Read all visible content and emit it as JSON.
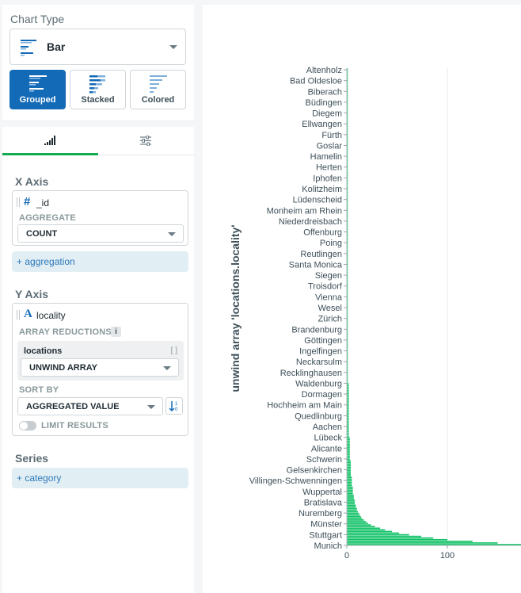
{
  "chart_type": {
    "title": "Chart Type",
    "selected": "Bar",
    "subtypes": [
      {
        "label": "Grouped",
        "active": true
      },
      {
        "label": "Stacked",
        "active": false
      },
      {
        "label": "Colored",
        "active": false
      }
    ]
  },
  "encode": {
    "tabs": [
      {
        "icon": "bar-signal-icon",
        "active": true
      },
      {
        "icon": "sliders-icon",
        "active": false
      }
    ],
    "x_axis": {
      "title": "X Axis",
      "field": "_id",
      "field_icon": "#",
      "aggregate_label": "AGGREGATE",
      "aggregate_value": "COUNT",
      "add_label": "+ aggregation"
    },
    "y_axis": {
      "title": "Y Axis",
      "field": "locality",
      "field_icon": "A",
      "array_reductions_label": "ARRAY REDUCTIONS",
      "info": "i",
      "array_field": "locations",
      "array_field_icon": "[ ]",
      "reduction_value": "UNWIND ARRAY",
      "sort_label": "SORT BY",
      "sort_value": "AGGREGATED VALUE",
      "limit_label": "LIMIT RESULTS"
    },
    "series": {
      "title": "Series",
      "add_label": "+ category"
    }
  },
  "colors": {
    "accent_blue": "#136ab6",
    "bar_green": "#13c268",
    "active_tab": "#13aa52"
  },
  "chart_data": {
    "type": "bar",
    "orientation": "horizontal",
    "ylabel": "unwind array 'locations.locality'",
    "xlabel": "",
    "xlim": [
      0,
      175
    ],
    "x_ticks": [
      0,
      100
    ],
    "grid": true,
    "category_labels": [
      "Altenholz",
      "Bad Oldesloe",
      "Biberach",
      "Büdingen",
      "Diegem",
      "Ellwangen",
      "Fürth",
      "Goslar",
      "Hamelin",
      "Herten",
      "Iphofen",
      "Kolitzheim",
      "Lüdenscheid",
      "Monheim am Rhein",
      "Niederdreisbach",
      "Offenburg",
      "Poing",
      "Reutlingen",
      "Santa Monica",
      "Siegen",
      "Troisdorf",
      "Vienna",
      "Wesel",
      "Zürich",
      "Brandenburg",
      "Göttingen",
      "Ingelfingen",
      "Neckarsulm",
      "Recklinghausen",
      "Waldenburg",
      "Dormagen",
      "Hochheim am Main",
      "Quedlinburg",
      "Aachen",
      "Lübeck",
      "Alicante",
      "Schwerin",
      "Gelsenkirchen",
      "Villingen-Schwenningen",
      "Wuppertal",
      "Bratislava",
      "Nuremberg",
      "Münster",
      "Stuttgart",
      "Munich"
    ],
    "values": [
      1,
      1,
      1,
      1,
      1,
      1,
      1,
      1,
      1,
      1,
      1,
      1,
      1,
      1,
      1,
      1,
      1,
      1,
      1,
      1,
      1,
      1,
      1,
      1,
      1,
      1,
      1,
      1,
      1,
      1,
      1,
      1,
      1,
      1,
      1,
      1,
      1,
      1,
      1,
      1,
      1,
      1,
      1,
      1,
      1,
      1,
      1,
      1,
      1,
      1,
      1,
      1,
      1,
      1,
      1,
      1,
      1,
      1,
      1,
      1,
      1,
      1,
      1,
      1,
      1,
      1,
      1,
      1,
      1,
      1,
      1,
      1,
      1,
      1,
      1,
      1,
      1,
      1,
      1,
      1,
      1,
      1,
      1,
      1,
      1,
      1,
      1,
      1,
      1,
      1,
      1,
      1,
      1,
      1,
      1,
      1,
      1,
      1,
      1,
      1,
      1,
      1,
      1,
      1,
      1,
      1,
      1,
      1,
      1,
      1,
      1,
      1,
      1,
      1,
      1,
      1,
      1,
      1,
      1,
      1,
      1,
      1,
      1,
      1,
      1,
      1,
      1,
      1,
      1,
      1,
      1,
      1,
      1,
      1,
      1,
      1,
      1,
      1,
      1,
      1,
      1,
      1,
      1,
      1,
      1,
      1,
      1,
      1,
      1,
      1,
      1,
      1,
      1,
      1,
      1,
      1,
      1,
      1,
      1,
      1,
      1,
      1,
      1,
      1,
      1,
      1,
      1,
      1,
      1,
      1,
      1,
      1,
      1,
      1,
      1,
      1,
      1,
      1,
      1,
      1,
      1,
      1,
      1,
      1,
      1,
      1,
      1,
      1,
      1,
      1,
      1,
      1,
      2,
      2,
      2,
      2,
      2,
      2,
      2,
      2,
      2,
      2,
      2,
      2,
      2,
      2,
      2,
      2,
      2,
      2,
      2,
      2,
      2,
      2,
      2,
      2,
      2,
      2,
      2,
      2,
      2,
      2,
      2,
      2,
      2,
      3,
      3,
      3,
      3,
      3,
      3,
      3,
      3,
      3,
      3,
      3,
      3,
      3,
      3,
      4,
      4,
      4,
      4,
      4,
      4,
      4,
      4,
      4,
      4,
      5,
      5,
      5,
      5,
      5,
      5,
      6,
      6,
      6,
      6,
      6,
      7,
      7,
      7,
      8,
      8,
      8,
      9,
      9,
      10,
      10,
      11,
      12,
      13,
      14,
      15,
      17,
      19,
      21,
      24,
      28,
      33,
      38,
      45,
      52,
      62,
      74,
      86,
      100,
      125,
      150,
      175
    ]
  }
}
